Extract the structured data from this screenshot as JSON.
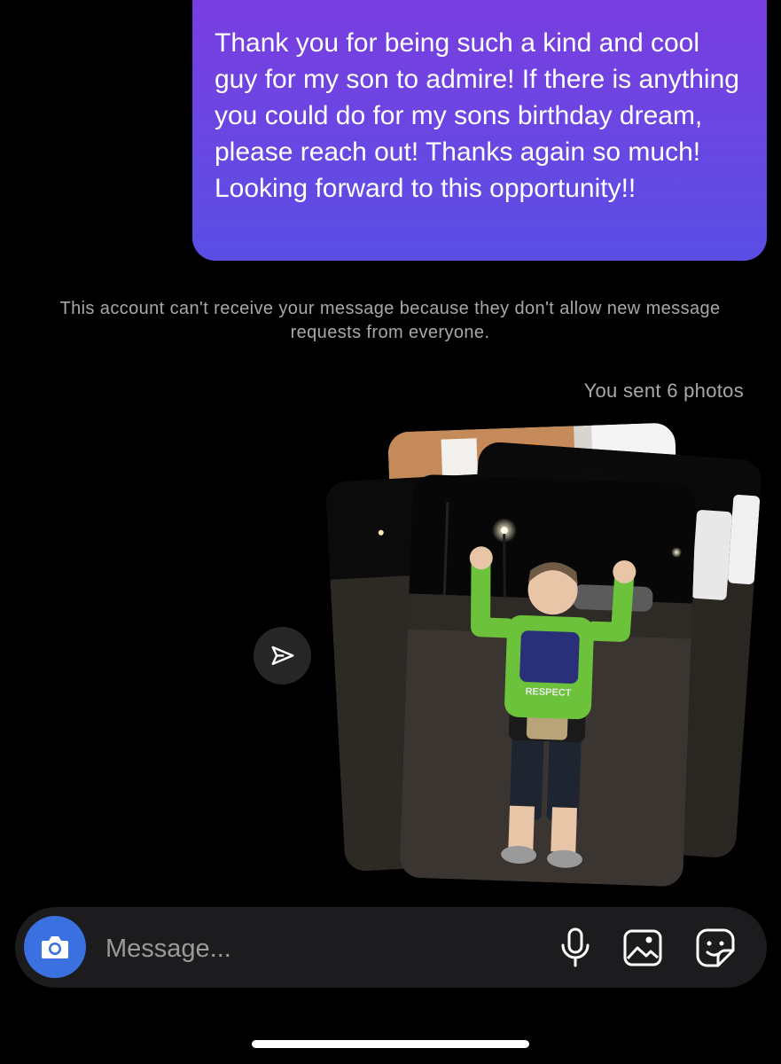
{
  "message": {
    "text": "Thank you for being such a kind and cool guy for my son to admire! If there is anything you could do for my sons birthday dream, please reach out! Thanks again so much! Looking forward to this opportunity!!"
  },
  "notice": {
    "text": "This account can't receive your message because they don't allow new message requests from everyone."
  },
  "photos": {
    "sent_label": "You sent 6 photos",
    "shirt_text": "RESPECT"
  },
  "composer": {
    "placeholder": "Message..."
  },
  "icons": {
    "share": "send-icon",
    "camera": "camera-icon",
    "mic": "microphone-icon",
    "gallery": "gallery-icon",
    "sticker": "sticker-icon"
  },
  "colors": {
    "bubble_top": "#7a3ee0",
    "bubble_bottom": "#5a4ee4",
    "camera_button": "#3a70e0",
    "composer_bg": "#1c1c1e",
    "shirt_green": "#6cc23a"
  }
}
